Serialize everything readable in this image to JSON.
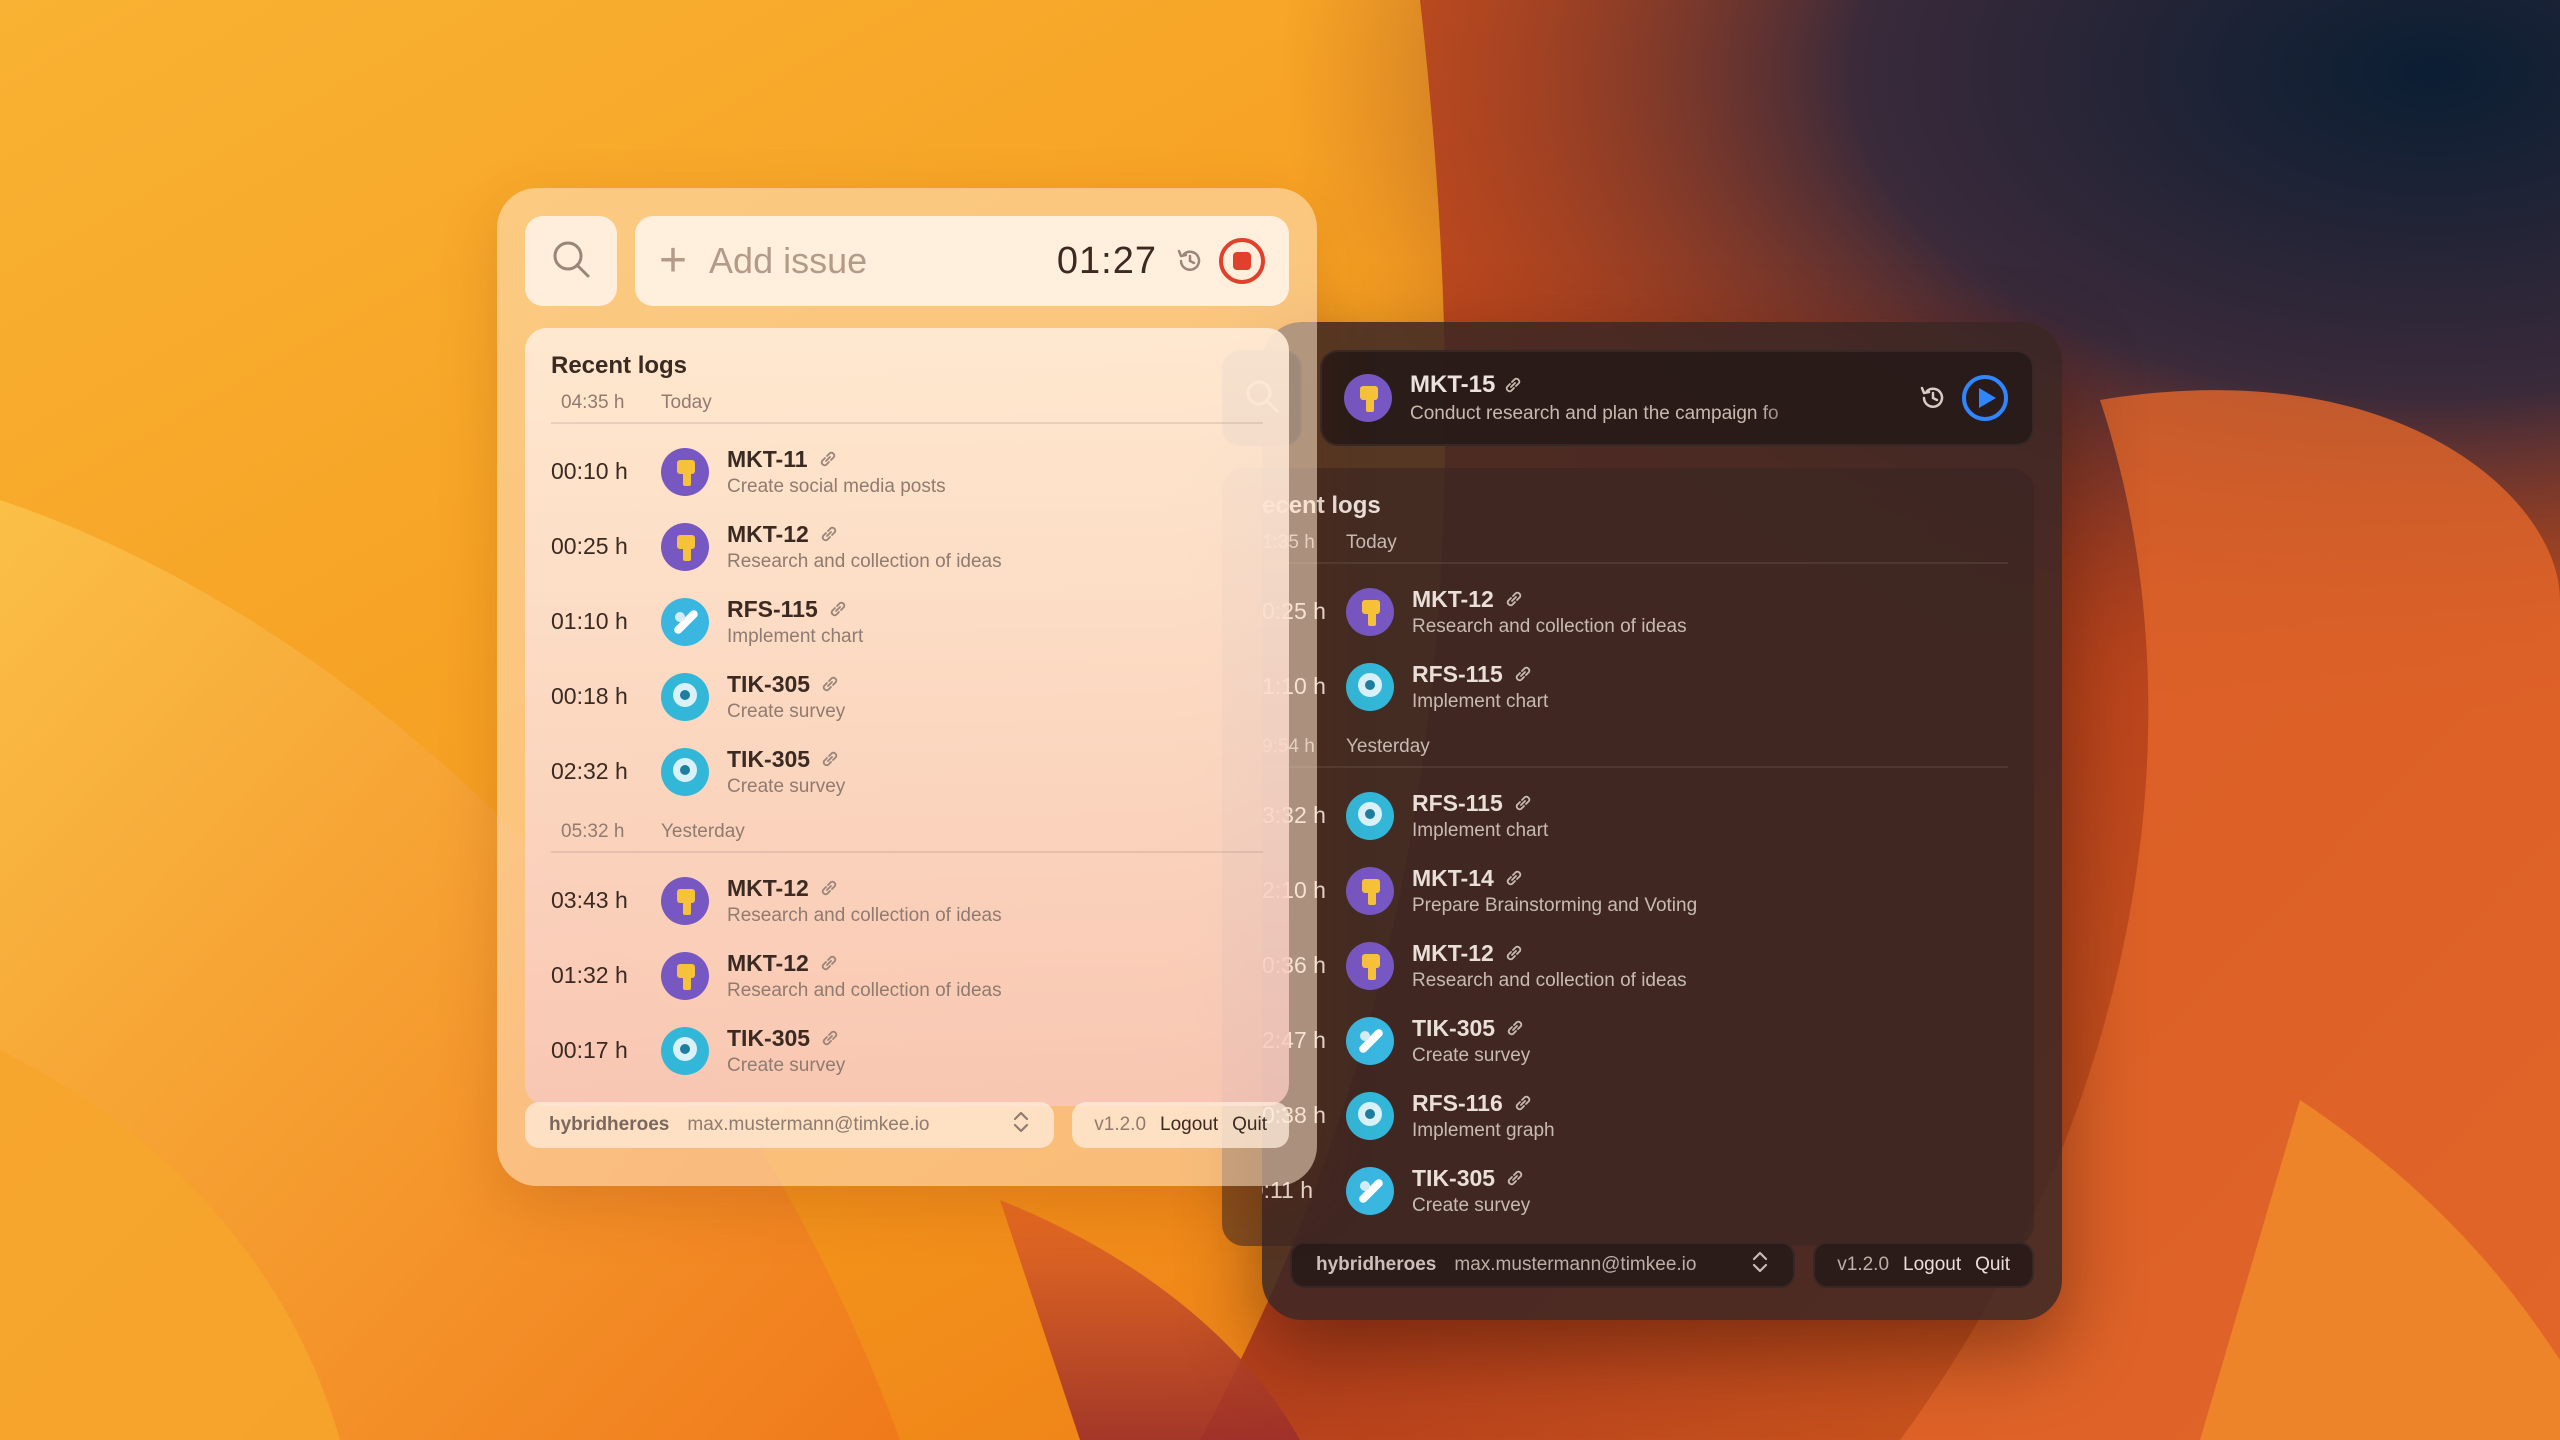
{
  "colors": {
    "stop": "#e0402c",
    "play": "#2f86ff",
    "mkt_avatar": "#7757c2",
    "tik_avatar": "#33b7d8",
    "rfs_avatar": "#39b7e0"
  },
  "light_panel": {
    "add_placeholder": "Add issue",
    "timer": "01:27",
    "recent_title": "Recent logs",
    "groups": [
      {
        "total": "04:35 h",
        "day": "Today",
        "rows": [
          {
            "duration": "00:10 h",
            "key": "MKT-11",
            "summary": "Create social media posts",
            "avatar": "mkt"
          },
          {
            "duration": "00:25 h",
            "key": "MKT-12",
            "summary": "Research and collection of ideas",
            "avatar": "mkt"
          },
          {
            "duration": "01:10 h",
            "key": "RFS-115",
            "summary": "Implement chart",
            "avatar": "rfs"
          },
          {
            "duration": "00:18 h",
            "key": "TIK-305",
            "summary": "Create survey",
            "avatar": "tik"
          },
          {
            "duration": "02:32 h",
            "key": "TIK-305",
            "summary": "Create survey",
            "avatar": "tik"
          }
        ]
      },
      {
        "total": "05:32 h",
        "day": "Yesterday",
        "rows": [
          {
            "duration": "03:43 h",
            "key": "MKT-12",
            "summary": "Research and collection of ideas",
            "avatar": "mkt"
          },
          {
            "duration": "01:32 h",
            "key": "MKT-12",
            "summary": "Research and collection of ideas",
            "avatar": "mkt"
          },
          {
            "duration": "00:17 h",
            "key": "TIK-305",
            "summary": "Create survey",
            "avatar": "tik"
          }
        ]
      }
    ],
    "footer": {
      "workspace": "hybridheroes",
      "email": "max.mustermann@timkee.io",
      "version": "v1.2.0",
      "logout": "Logout",
      "quit": "Quit"
    }
  },
  "dark_panel": {
    "current_issue": {
      "key": "MKT-15",
      "summary": "Conduct research and plan the campaign fo"
    },
    "recent_title": "ecent logs",
    "groups": [
      {
        "total": "1:35 h",
        "day": "Today",
        "rows": [
          {
            "duration": "0:25 h",
            "key": "MKT-12",
            "summary": "Research and collection of ideas",
            "avatar": "mkt"
          },
          {
            "duration": "1:10 h",
            "key": "RFS-115",
            "summary": "Implement chart",
            "avatar": "tik"
          }
        ]
      },
      {
        "total": "9:54 h",
        "day": "Yesterday",
        "rows": [
          {
            "duration": "3:32 h",
            "key": "RFS-115",
            "summary": "Implement chart",
            "avatar": "tik"
          },
          {
            "duration": "2:10 h",
            "key": "MKT-14",
            "summary": "Prepare Brainstorming and Voting",
            "avatar": "mkt"
          },
          {
            "duration": "0:36 h",
            "key": "MKT-12",
            "summary": "Research and collection of ideas",
            "avatar": "mkt"
          },
          {
            "duration": "2:47 h",
            "key": "TIK-305",
            "summary": "Create survey",
            "avatar": "rfs"
          },
          {
            "duration": "0:38 h",
            "key": "RFS-116",
            "summary": "Implement graph",
            "avatar": "tik"
          },
          {
            "duration": "00:11 h",
            "key": "TIK-305",
            "summary": "Create survey",
            "avatar": "rfs"
          }
        ]
      }
    ],
    "footer": {
      "workspace": "hybridheroes",
      "email": "max.mustermann@timkee.io",
      "version": "v1.2.0",
      "logout": "Logout",
      "quit": "Quit"
    }
  }
}
